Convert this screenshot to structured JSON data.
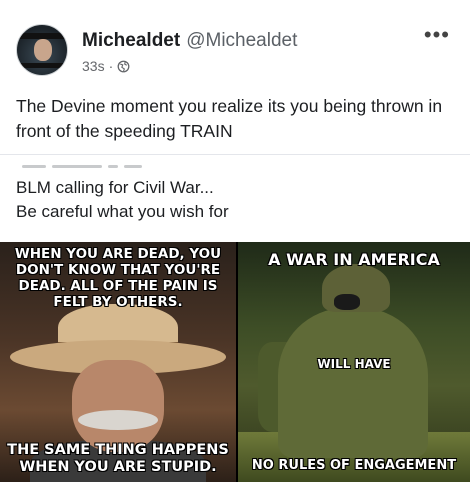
{
  "post": {
    "display_name": "Michealdet",
    "handle": "@Michealdet",
    "time": "33s",
    "separator": "·",
    "text": "The Devine moment you realize its you being thrown in front of the speeding TRAIN",
    "more_icon": "more-options-icon",
    "privacy_icon": "globe-icon"
  },
  "shared": {
    "line1": "BLM calling for Civil War...",
    "line2": "Be careful what you wish for"
  },
  "meme_left": {
    "top": "WHEN YOU ARE DEAD, YOU DON'T KNOW THAT YOU'RE DEAD. ALL OF THE PAIN IS FELT BY OTHERS.",
    "bottom": "THE SAME THING HAPPENS WHEN YOU ARE STUPID."
  },
  "meme_right": {
    "top": "A WAR IN AMERICA",
    "middle": "WILL HAVE",
    "bottom": "NO RULES OF ENGAGEMENT"
  }
}
